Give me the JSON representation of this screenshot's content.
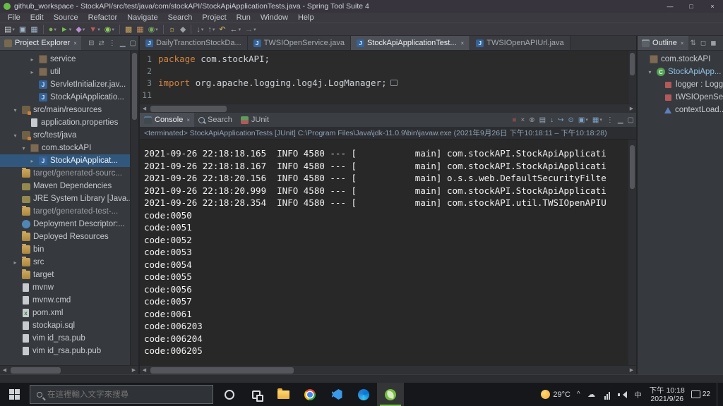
{
  "colors": {
    "keyword": "#d0823e",
    "selection": "#31577d",
    "console_text": "#f0f0f0",
    "sts_green": "#68bd45"
  },
  "glyphs": {
    "dropdown": "▾",
    "chevron_collapsed": "▸",
    "chevron_expanded": "▾",
    "close": "×",
    "scroll_left": "◀",
    "scroll_right": "▶"
  },
  "window": {
    "title": "github_workspace - StockAPI/src/test/java/com/stockAPI/StockApiApplicationTests.java - Spring Tool Suite 4",
    "controls": [
      {
        "name": "minimize-button",
        "glyph": "—"
      },
      {
        "name": "maximize-button",
        "glyph": "□"
      },
      {
        "name": "close-button",
        "glyph": "×"
      }
    ]
  },
  "menubar": [
    "File",
    "Edit",
    "Source",
    "Refactor",
    "Navigate",
    "Search",
    "Project",
    "Run",
    "Window",
    "Help"
  ],
  "toolbar": [
    {
      "name": "new-wizard-button",
      "glyph": "▤",
      "color": "#c9cdd1",
      "dd": true
    },
    {
      "name": "save-button",
      "glyph": "▣",
      "color": "#9fb6c9"
    },
    {
      "name": "save-all-button",
      "glyph": "▦",
      "color": "#9fb6c9"
    },
    {
      "name": "debug-button",
      "glyph": "●",
      "color": "#7cb54e",
      "dd": true,
      "sep": true
    },
    {
      "name": "run-button",
      "glyph": "►",
      "color": "#6fbf4e",
      "dd": true
    },
    {
      "name": "profile-button",
      "glyph": "◆",
      "color": "#b98fd1",
      "dd": true
    },
    {
      "name": "coverage-button",
      "glyph": "▼",
      "color": "#c05a5a",
      "dd": true
    },
    {
      "name": "external-tools-button",
      "glyph": "◉",
      "color": "#8fd05f",
      "dd": true
    },
    {
      "name": "new-java-project-button",
      "glyph": "▩",
      "color": "#caa45f",
      "sep": true
    },
    {
      "name": "new-package-button",
      "glyph": "▦",
      "color": "#c08a5a"
    },
    {
      "name": "new-class-button",
      "glyph": "◉",
      "color": "#74a85c",
      "dd": true
    },
    {
      "name": "search-button",
      "glyph": "☼",
      "color": "#d9c36a",
      "sep": true
    },
    {
      "name": "mark-occurrences-button",
      "glyph": "◆",
      "color": "#9aa0a6"
    },
    {
      "name": "next-annotation-button",
      "glyph": "↓",
      "color": "#9aa0a6",
      "dd": true,
      "sep": true
    },
    {
      "name": "previous-annotation-button",
      "glyph": "↑",
      "color": "#9aa0a6",
      "dd": true
    },
    {
      "name": "last-edit-location-button",
      "glyph": "↶",
      "color": "#d3b55f"
    },
    {
      "name": "back-button",
      "glyph": "←",
      "color": "#c9cdd1",
      "dd": true
    },
    {
      "name": "forward-button",
      "glyph": "→",
      "color": "#70757b",
      "dd": true
    }
  ],
  "explorer": {
    "tabs": [
      {
        "label": "Project Explorer",
        "icon": "explorer",
        "active": true,
        "close": true
      }
    ],
    "header_icons": [
      {
        "name": "collapse-all-icon",
        "glyph": "⊟"
      },
      {
        "name": "link-with-editor-icon",
        "glyph": "⇄"
      },
      {
        "name": "view-menu-icon",
        "glyph": "⋮"
      },
      {
        "name": "minimize-view-icon",
        "glyph": "▁"
      },
      {
        "name": "maximize-view-icon",
        "glyph": "▢"
      }
    ],
    "tree": [
      {
        "label": "service",
        "icon": "package",
        "indent": 3,
        "chevron": "collapsed"
      },
      {
        "label": "util",
        "icon": "package",
        "indent": 3,
        "chevron": "collapsed"
      },
      {
        "label": "ServletInitializer.jav...",
        "icon": "java",
        "indent": 3
      },
      {
        "label": "StockApiApplicatio...",
        "icon": "java",
        "indent": 3
      },
      {
        "label": "src/main/resources",
        "icon": "srcfolder",
        "indent": 1,
        "chevron": "expanded"
      },
      {
        "label": "application.properties",
        "icon": "file",
        "indent": 2
      },
      {
        "label": "src/test/java",
        "icon": "srcfolder",
        "indent": 1,
        "chevron": "expanded"
      },
      {
        "label": "com.stockAPI",
        "icon": "package",
        "indent": 2,
        "chevron": "expanded"
      },
      {
        "label": "StockApiApplicat...",
        "icon": "java",
        "indent": 3,
        "chevron": "collapsed",
        "selected": true
      },
      {
        "label": "target/generated-sourc...",
        "icon": "folder",
        "indent": 1,
        "dim": true
      },
      {
        "label": "Maven Dependencies",
        "icon": "library",
        "indent": 1
      },
      {
        "label": "JRE System Library [Java...",
        "icon": "library",
        "indent": 1
      },
      {
        "label": "target/generated-test-...",
        "icon": "folder",
        "indent": 1,
        "dim": true
      },
      {
        "label": "Deployment Descriptor:...",
        "icon": "descriptor",
        "indent": 1
      },
      {
        "label": "Deployed Resources",
        "icon": "folder",
        "indent": 1
      },
      {
        "label": "bin",
        "icon": "folder",
        "indent": 1
      },
      {
        "label": "src",
        "icon": "folder",
        "indent": 1,
        "chevron": "collapsed"
      },
      {
        "label": "target",
        "icon": "folder",
        "indent": 1
      },
      {
        "label": "mvnw",
        "icon": "file",
        "indent": 1
      },
      {
        "label": "mvnw.cmd",
        "icon": "file",
        "indent": 1
      },
      {
        "label": "pom.xml",
        "icon": "xml",
        "indent": 1
      },
      {
        "label": "stockapi.sql",
        "icon": "file",
        "indent": 1
      },
      {
        "label": "vim id_rsa.pub",
        "icon": "file",
        "indent": 1
      },
      {
        "label": "vim id_rsa.pub.pub",
        "icon": "file",
        "indent": 1
      }
    ]
  },
  "editor": {
    "tabs": [
      {
        "label": "DailyTranctionStockDa...",
        "active": false
      },
      {
        "label": "TWSIOpenService.java",
        "active": false
      },
      {
        "label": "StockApiApplicationTest...",
        "active": true
      },
      {
        "label": "TWSIOpenAPIUrl.java",
        "active": false
      }
    ],
    "lines": [
      {
        "num": "1",
        "tokens": [
          {
            "t": "package ",
            "c": "keyword"
          },
          {
            "t": "com.stockAPI;",
            "c": "plain"
          }
        ]
      },
      {
        "num": "2",
        "tokens": []
      },
      {
        "num": "3",
        "tokens": [
          {
            "t": "import ",
            "c": "keyword"
          },
          {
            "t": "org.apache.logging.log4j.LogManager;",
            "c": "plain"
          }
        ],
        "folded": true
      },
      {
        "num": "11",
        "tokens": []
      }
    ]
  },
  "console": {
    "tabs": [
      {
        "label": "Console",
        "icon": "console",
        "active": true,
        "close": true
      },
      {
        "label": "Search",
        "icon": "search"
      },
      {
        "label": "JUnit",
        "icon": "junit"
      }
    ],
    "toolbar_icons": [
      {
        "name": "terminate-icon",
        "glyph": "■",
        "color": "#7e4a4a"
      },
      {
        "name": "remove-launch-icon",
        "glyph": "×",
        "color": "#9aa0a6"
      },
      {
        "name": "remove-all-launches-icon",
        "glyph": "⊗",
        "color": "#9aa0a6"
      },
      {
        "name": "clear-console-icon",
        "glyph": "▤",
        "color": "#9aa7b3"
      },
      {
        "name": "scroll-lock-icon",
        "glyph": "↓",
        "color": "#8fa6c0"
      },
      {
        "name": "word-wrap-icon",
        "glyph": "↪",
        "color": "#7fa3c8"
      },
      {
        "name": "pin-console-icon",
        "glyph": "⊙",
        "color": "#7fa3c8"
      },
      {
        "name": "display-selected-console-icon",
        "glyph": "▣",
        "color": "#7fa3c8",
        "dd": true
      },
      {
        "name": "open-console-icon",
        "glyph": "▦",
        "color": "#7fa3c8",
        "dd": true
      },
      {
        "name": "view-menu-icon",
        "glyph": "⋮",
        "color": "#9aa0a6"
      },
      {
        "name": "minimize-view-icon",
        "glyph": "▁",
        "color": "#9aa0a6"
      },
      {
        "name": "maximize-view-icon",
        "glyph": "▢",
        "color": "#9aa0a6"
      }
    ],
    "status": "<terminated> StockApiApplicationTests [JUnit] C:\\Program Files\\Java\\jdk-11.0.9\\bin\\javaw.exe (2021年9月26日 下午10:18:11 – 下午10:18:28)",
    "lines": [
      "2021-09-26 22:18:18.165  INFO 4580 --- [           main] com.stockAPI.StockApiApplicati",
      "2021-09-26 22:18:18.167  INFO 4580 --- [           main] com.stockAPI.StockApiApplicati",
      "2021-09-26 22:18:20.156  INFO 4580 --- [           main] o.s.s.web.DefaultSecurityFilte",
      "2021-09-26 22:18:20.999  INFO 4580 --- [           main] com.stockAPI.StockApiApplicati",
      "2021-09-26 22:18:28.354  INFO 4580 --- [           main] com.stockAPI.util.TWSIOpenAPIU",
      "code:0050",
      "code:0051",
      "code:0052",
      "code:0053",
      "code:0054",
      "code:0055",
      "code:0056",
      "code:0057",
      "code:0061",
      "code:006203",
      "code:006204",
      "code:006205"
    ]
  },
  "outline": {
    "tabs": [
      {
        "label": "Outline",
        "icon": "outline",
        "active": true,
        "close": true
      }
    ],
    "header_icons": [
      {
        "name": "sort-icon",
        "glyph": "⇅"
      },
      {
        "name": "hide-fields-icon",
        "glyph": "◻"
      },
      {
        "name": "hide-static-members-icon",
        "glyph": "◼"
      },
      {
        "name": "view-menu-icon",
        "glyph": "⋮"
      }
    ],
    "items": [
      {
        "label": "com.stockAPI",
        "icon": "package",
        "indent": 0
      },
      {
        "label": "StockApiApp...",
        "icon": "class",
        "indent": 1,
        "chevron": "expanded",
        "color": "#8fc1e3"
      },
      {
        "label": "logger : Logg...",
        "icon": "field",
        "indent": 2
      },
      {
        "label": "tWSIOpenSe...",
        "icon": "field",
        "indent": 2
      },
      {
        "label": "contextLoad...",
        "icon": "method",
        "indent": 2
      }
    ]
  },
  "taskbar": {
    "search_placeholder": "在這裡輸入文字來搜尋",
    "apps": [
      {
        "name": "cortana-button",
        "icon": "cortana"
      },
      {
        "name": "task-view-button",
        "icon": "task-view"
      },
      {
        "name": "file-explorer-button",
        "icon": "file-explorer"
      },
      {
        "name": "chrome-button",
        "icon": "chrome"
      },
      {
        "name": "vscode-button",
        "icon": "vscode"
      },
      {
        "name": "edge-button",
        "icon": "edge"
      },
      {
        "name": "spring-tool-suite-button",
        "icon": "sts",
        "active": true
      }
    ],
    "tray": {
      "weather": "29°C",
      "expand": "^",
      "icons": [
        {
          "name": "onedrive-icon",
          "icon": "cloud"
        },
        {
          "name": "network-icon",
          "icon": "network"
        },
        {
          "name": "volume-icon",
          "icon": "volume"
        },
        {
          "name": "ime-indicator",
          "icon": "ime"
        }
      ],
      "ime_label": "中",
      "time": "下午 10:18",
      "date": "2021/9/26",
      "badge": "22"
    }
  }
}
